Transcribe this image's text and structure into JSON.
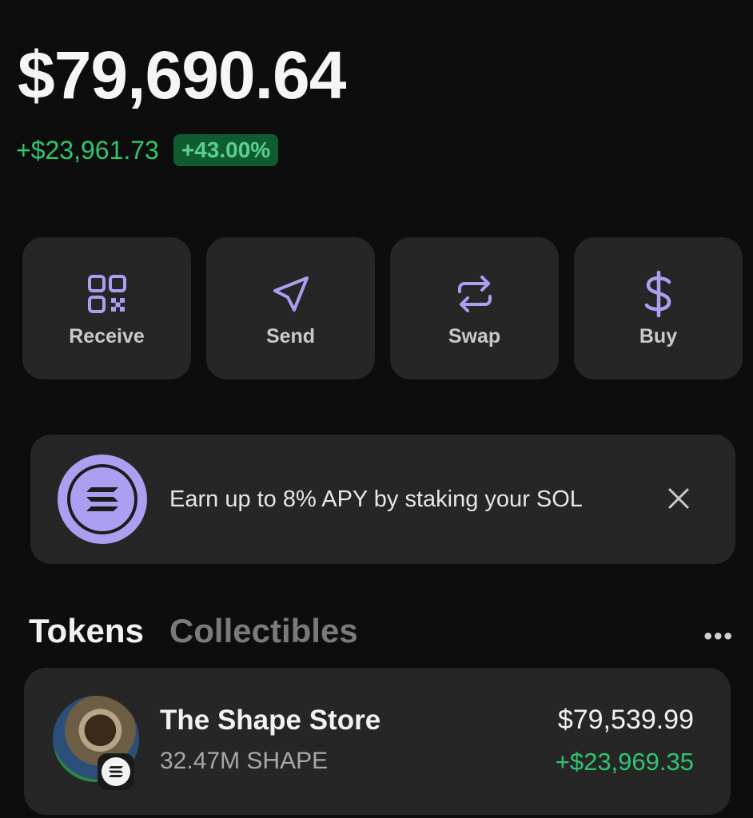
{
  "balance": "$79,690.64",
  "change": {
    "absolute": "+$23,961.73",
    "percent": "+43.00%"
  },
  "actions": [
    {
      "label": "Receive",
      "icon": "qr-code-icon"
    },
    {
      "label": "Send",
      "icon": "send-icon"
    },
    {
      "label": "Swap",
      "icon": "swap-icon"
    },
    {
      "label": "Buy",
      "icon": "dollar-icon"
    }
  ],
  "banner": {
    "text": "Earn up to 8% APY by staking your SOL",
    "icon": "solana-icon",
    "close_icon": "close-icon"
  },
  "tabs": [
    {
      "label": "Tokens",
      "active": true
    },
    {
      "label": "Collectibles",
      "active": false
    }
  ],
  "more_label": "•••",
  "tokens": [
    {
      "name": "The Shape Store",
      "amount": "32.47M SHAPE",
      "value": "$79,539.99",
      "change": "+$23,969.35"
    }
  ],
  "colors": {
    "accent": "#ab9ff2",
    "positive": "#2ec66f",
    "card": "#262626",
    "background": "#0d0d0d"
  }
}
